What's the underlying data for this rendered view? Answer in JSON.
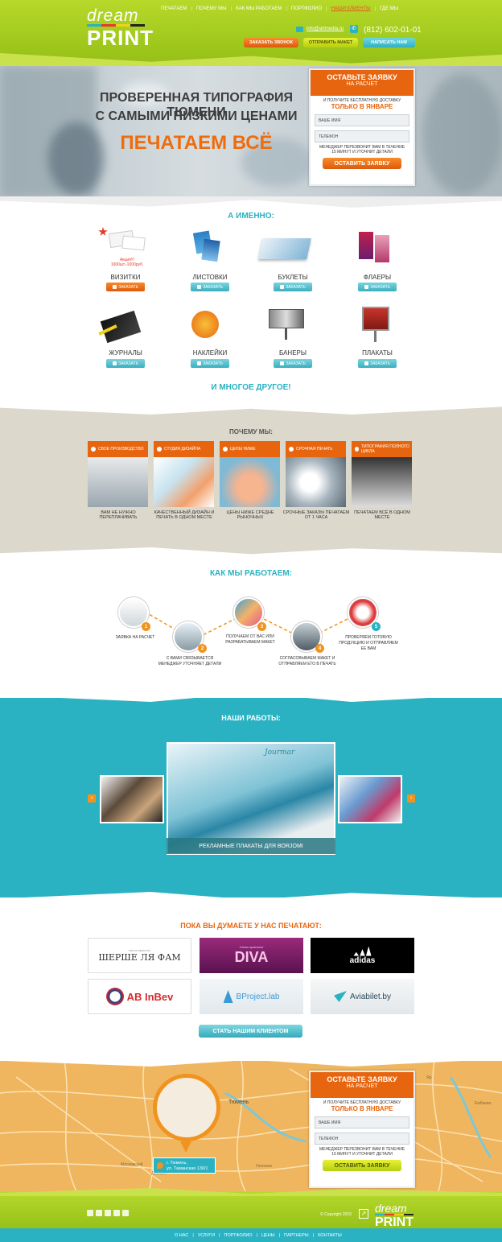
{
  "header": {
    "logo_dream": "dream",
    "logo_print": "PRINT",
    "nav": [
      "ПЕЧАТАЕМ",
      "ПОЧЕМУ МЫ",
      "КАК МЫ РАБОТАЕМ",
      "ПОРТФОЛИО",
      "НАШИ КЛИЕНТЫ",
      "ГДЕ МЫ"
    ],
    "email": "info@artmedia.ru",
    "phone": "(812) 602-01-01",
    "btn_call": "ЗАКАЗАТЬ ЗВОНОК",
    "btn_send": "ОТПРАВИТЬ МАКЕТ",
    "btn_write": "НАПИСАТЬ НАМ"
  },
  "hero": {
    "line1": "ПРОВЕРЕННАЯ ТИПОГРАФИЯ ТЮМЕНИ",
    "line2": "С САМЫМИ НИЗКИМИ ЦЕНАМИ",
    "big": "ПЕЧАТАЕМ ВСЁ"
  },
  "form": {
    "title": "ОСТАВЬТЕ ЗАЯВКУ",
    "subtitle": "НА РАСЧЕТ",
    "promo": "И ПОЛУЧИТЕ БЕСПЛАТНУЮ ДОСТАВКУ",
    "promo_strong": "ТОЛЬКО В ЯНВАРЕ",
    "name_placeholder": "ВАШЕ ИМЯ",
    "phone_placeholder": "ТЕЛЕФОН",
    "note": "МЕНЕДЖЕР ПЕРЕЗВОНИТ ВАМ В ТЕЧЕНИЕ 15 МИНУТ И УТОЧНИТ ДЕТАЛИ",
    "submit": "ОСТАВИТЬ ЗАЯВКУ"
  },
  "services": {
    "title": "А ИМЕННО:",
    "order_label": "ЗАКАЗАТЬ",
    "promo_line1": "Акция!!!",
    "promo_line2": "1000шт.-1000руб.",
    "items": [
      "ВИЗИТКИ",
      "ЛИСТОВКИ",
      "БУКЛЕТЫ",
      "ФЛАЕРЫ",
      "ЖУРНАЛЫ",
      "НАКЛЕЙКИ",
      "БАНЕРЫ",
      "ПЛАКАТЫ"
    ],
    "more": "И МНОГОЕ ДРУГОЕ!"
  },
  "why": {
    "title": "ПОЧЕМУ МЫ:",
    "cards": [
      {
        "head": "СВОЕ ПРОИЗВОДСТВО",
        "caption": "ВАМ НЕ НУЖНО ПЕРЕПЛАЧИВАТЬ"
      },
      {
        "head": "СТУДИЯ ДИЗАЙНА",
        "caption": "КАЧЕСТВЕННЫЙ ДИЗАЙН И ПЕЧАТЬ В ОДНОМ МЕСТЕ"
      },
      {
        "head": "ЦЕНЫ НИЖЕ",
        "caption": "ЦЕНЫ НИЖЕ СРЕДНЕ РЫНОЧНЫХ"
      },
      {
        "head": "СРОЧНАЯ ПЕЧАТЬ",
        "caption": "СРОЧНЫЕ ЗАКАЗЫ ПЕЧАТАЕМ ОТ 1 ЧАСА"
      },
      {
        "head": "ТИПОГРАФИЯ ПОЛНОГО ЦИКЛА",
        "caption": "ПЕЧАТАЕМ ВСЁ В ОДНОМ МЕСТЕ"
      }
    ]
  },
  "how": {
    "title": "КАК МЫ РАБОТАЕМ:",
    "steps": [
      {
        "n": "1",
        "text": "ЗАЯВКА НА РАСЧЕТ"
      },
      {
        "n": "2",
        "text": "С ВАМИ СВЯЗЫВАЕТСЯ МЕНЕДЖЕР УТОЧНЯЕТ ДЕТАЛИ"
      },
      {
        "n": "3",
        "text": "ПОЛУЧАЕМ ОТ ВАС ИЛИ РАЗРАБАТЫВАЕМ МАКЕТ"
      },
      {
        "n": "4",
        "text": "СОГЛАСОВЫВАЕМ МАКЕТ И ОТПРАВЛЯЕМ ЕГО В ПЕЧАТЬ"
      },
      {
        "n": "5",
        "text": "ПРОВЕРЯЕМ ГОТОВУЮ ПРОДУКЦИЮ И ОТПРАВЛЯЕМ ЕЕ ВАМ"
      }
    ]
  },
  "works": {
    "title": "НАШИ РАБОТЫ:",
    "caption": "РЕКЛАМНЫЕ ПЛАКАТЫ ДЛЯ BORJOMI",
    "slide_brand": "Jourmar"
  },
  "clients": {
    "title": "ПОКА ВЫ ДУМАЕТЕ У НАС ПЕЧАТАЮТ:",
    "logos": [
      "ШЕРШЕ ЛЯ ФАМ",
      "DIVA",
      "adidas",
      "AB InBev",
      "BProject.lab",
      "Aviabilet.by"
    ],
    "diva_small": "Салон красоты",
    "sherche_small": "салон красоты",
    "cta": "СТАТЬ НАШИМ КЛИЕНТОМ"
  },
  "map": {
    "address_line1": "г. Тюмень,",
    "address_line2": "ул. Таманская 130/1",
    "city_label": "Тюмень",
    "streets": [
      "Московский",
      "Дивизия",
      "Ембаево",
      "Онохино",
      "Яр"
    ]
  },
  "footer": {
    "copyright": "© Copyright  2015",
    "logo_dream": "dream",
    "logo_print": "PRINT",
    "nav": [
      "О НАС",
      "УСЛУГИ",
      "ПОРТФОЛИО",
      "ЦЕНЫ",
      "ПАРТНЕРЫ",
      "КОНТАКТЫ"
    ]
  },
  "colors": {
    "green": "#a6cf20",
    "orange": "#e8650f",
    "teal": "#2ab2c2"
  }
}
